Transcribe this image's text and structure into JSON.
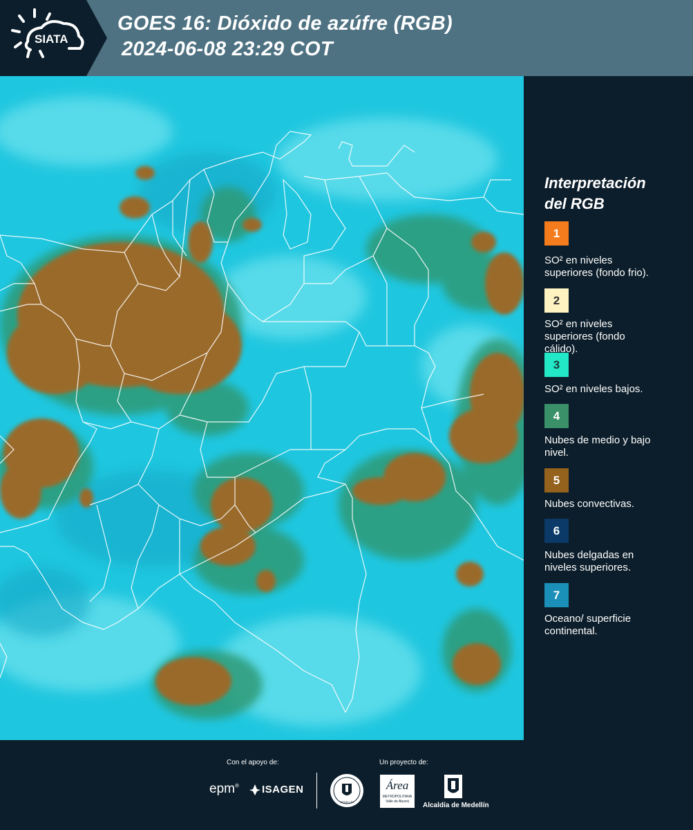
{
  "header": {
    "logo_text": "SIATA",
    "title_line1": "GOES 16: Dióxido de azúfre (RGB)",
    "title_line2": "2024-06-08 23:29 COT",
    "background_color": "#4e7282",
    "logo_background_color": "#0c1e2b"
  },
  "legend": {
    "title_line1": "Interpretación",
    "title_line2": "del RGB",
    "items": [
      {
        "number": "1",
        "color": "#f57c1c",
        "text_color": "#ffffff",
        "label_lines": [
          "SO² en niveles",
          "superiores (fondo frio)."
        ]
      },
      {
        "number": "2",
        "color": "#fff3c2",
        "text_color": "#333333",
        "label_lines": [
          "SO² en niveles",
          "superiores (fondo",
          "cálido)."
        ]
      },
      {
        "number": "3",
        "color": "#22e8c8",
        "text_color": "#1a3a3a",
        "label_lines": [
          "SO² en niveles bajos."
        ]
      },
      {
        "number": "4",
        "color": "#3a9068",
        "text_color": "#ffffff",
        "label_lines": [
          "Nubes de medio y bajo",
          "nivel."
        ]
      },
      {
        "number": "5",
        "color": "#94621c",
        "text_color": "#ffffff",
        "label_lines": [
          "Nubes convectivas."
        ]
      },
      {
        "number": "6",
        "color": "#0b3a68",
        "text_color": "#ffffff",
        "label_lines": [
          "Nubes delgadas en",
          "niveles superiores."
        ]
      },
      {
        "number": "7",
        "color": "#1a8fb8",
        "text_color": "#ffffff",
        "label_lines": [
          "Oceano/ superficie",
          "continental."
        ]
      }
    ]
  },
  "map": {
    "background_color": "#1ec7e0",
    "convective_color": "#9a6a2a",
    "border_color": "#ffffff"
  },
  "footer": {
    "support_label": "Con el apoyo de:",
    "project_label": "Un proyecto de:",
    "sponsors": [
      "epm",
      "ISAGEN"
    ],
    "partners": [
      "Área Metropolitana Valle de Aburrá",
      "Alcaldía de Medellín"
    ],
    "epm_text": "epm",
    "isagen_text": "ISAGEN",
    "area_text": "Área",
    "area_sub": "METROPOLITANA",
    "area_sub2": "Valle de Aburrá",
    "alcaldia_text": "Alcaldía de Medellín",
    "medellin_text": "MEDELLÍN"
  }
}
